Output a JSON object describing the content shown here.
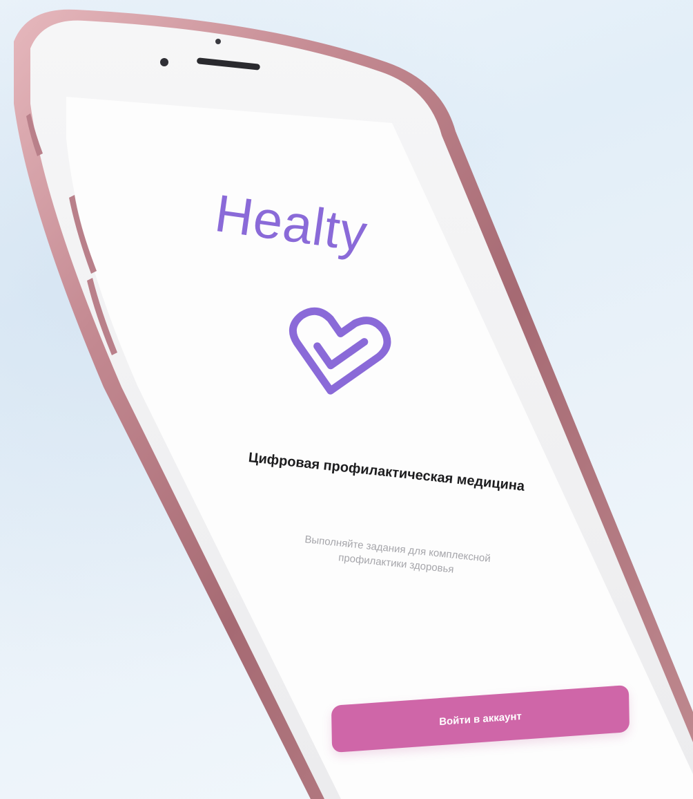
{
  "app": {
    "brand_name": "Healty",
    "logo_icon": "heart-check-icon"
  },
  "onboarding": {
    "headline": "Цифровая профилактическая медицина",
    "subtext": "Выполняйте задания для комплексной профилактики здоровья",
    "login_button_label": "Войти в аккаунт"
  },
  "colors": {
    "brand_purple": "#8a6ad8",
    "button_pink": "#cf66a8",
    "phone_frame_rose": "#c98e96",
    "background": "#e6f0f8",
    "screen_white": "#ffffff"
  }
}
